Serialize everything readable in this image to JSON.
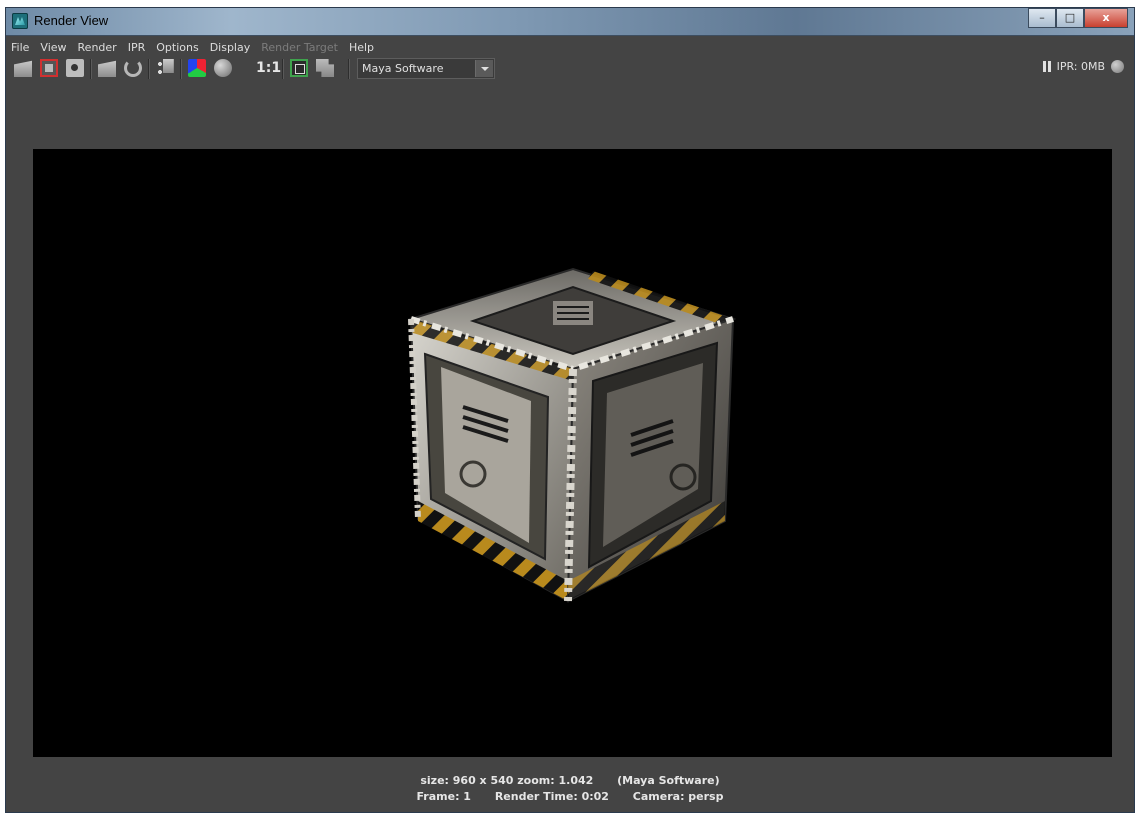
{
  "window": {
    "title": "Render View"
  },
  "caption_buttons": {
    "minimize": "–",
    "maximize": "□",
    "close": "x"
  },
  "menubar": [
    "File",
    "View",
    "Render",
    "IPR",
    "Options",
    "Display",
    "Render Target",
    "Help"
  ],
  "toolbar": {
    "ratio_label": "1:1",
    "renderer_select": "Maya Software",
    "ipr_label": "IPR: 0MB"
  },
  "status": {
    "size_zoom": "size: 960 x 540 zoom: 1.042",
    "renderer": "(Maya Software)",
    "frame": "Frame: 1",
    "render_time": "Render Time: 0:02",
    "camera": "Camera: persp"
  }
}
